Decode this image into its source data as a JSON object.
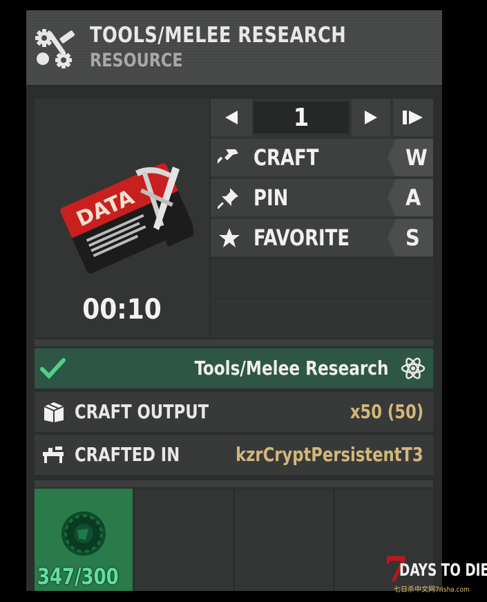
{
  "header": {
    "title": "TOOLS/MELEE RESEARCH",
    "subtitle": "RESOURCE",
    "icon": "gears-tools-icon"
  },
  "item": {
    "icon": "data-card-icon",
    "card_text": "DATA",
    "craft_time": "00:10"
  },
  "quantity": {
    "value": "1",
    "decrease_icon": "arrow-left-icon",
    "increase_icon": "arrow-right-icon",
    "max_icon": "arrow-max-icon"
  },
  "actions": [
    {
      "label": "CRAFT",
      "key": "W",
      "icon": "hammer-icon"
    },
    {
      "label": "PIN",
      "key": "A",
      "icon": "pin-icon"
    },
    {
      "label": "FAVORITE",
      "key": "S",
      "icon": "star-icon"
    }
  ],
  "recipe": {
    "name": "Tools/Melee Research",
    "status_icon": "check-icon",
    "type_icon": "atom-icon"
  },
  "details": [
    {
      "label": "CRAFT OUTPUT",
      "value": "x50 (50)",
      "icon": "box-icon"
    },
    {
      "label": "CRAFTED IN",
      "value": "kzrCryptPersistentT3",
      "icon": "workbench-icon"
    }
  ],
  "ingredients": [
    {
      "count": "347/300",
      "icon": "gear-part-icon"
    }
  ],
  "watermark": {
    "number": "7",
    "text": "DAYS TO DIE",
    "sub": "七日杀中文网7risha.com"
  },
  "colors": {
    "panel": "#2c2e2e",
    "recipe_bg": "#2e5645",
    "value_gold": "#d3b77a",
    "slot_active": "#2a7a4a",
    "count_green": "#5fe0a0",
    "check_green": "#4fd08a"
  }
}
